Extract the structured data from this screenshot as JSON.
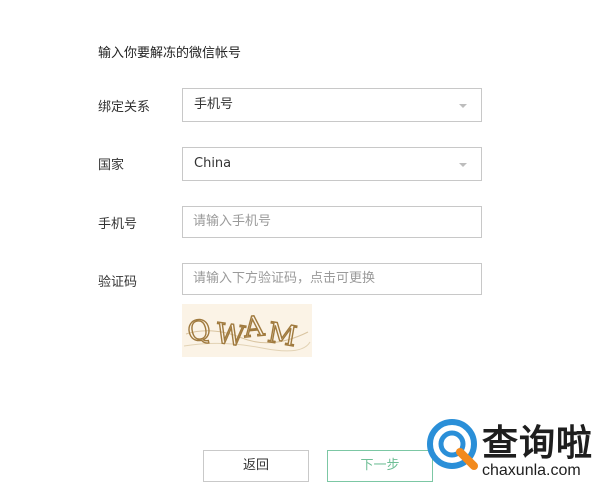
{
  "page": {
    "title": "输入你要解冻的微信帐号"
  },
  "form": {
    "bind_label": "绑定关系",
    "bind_value": "手机号",
    "country_label": "国家",
    "country_value": "China",
    "phone_label": "手机号",
    "phone_placeholder": "请输入手机号",
    "captcha_label": "验证码",
    "captcha_placeholder": "请输入下方验证码，点击可更换",
    "captcha_text": "QWAM"
  },
  "buttons": {
    "back_label": "返回",
    "next_label": "下一步"
  },
  "watermark": {
    "title": "查询啦",
    "domain": "chaxunla.com"
  },
  "colors": {
    "accent_green": "#6fbf96",
    "border": "#c8c8c8",
    "captcha_ink": "#a07a3e",
    "logo_blue": "#2a8fd8",
    "logo_orange": "#f28a1e"
  },
  "icons": {
    "dropdown": "caret-down-icon",
    "logo": "magnifier-q-logo"
  }
}
